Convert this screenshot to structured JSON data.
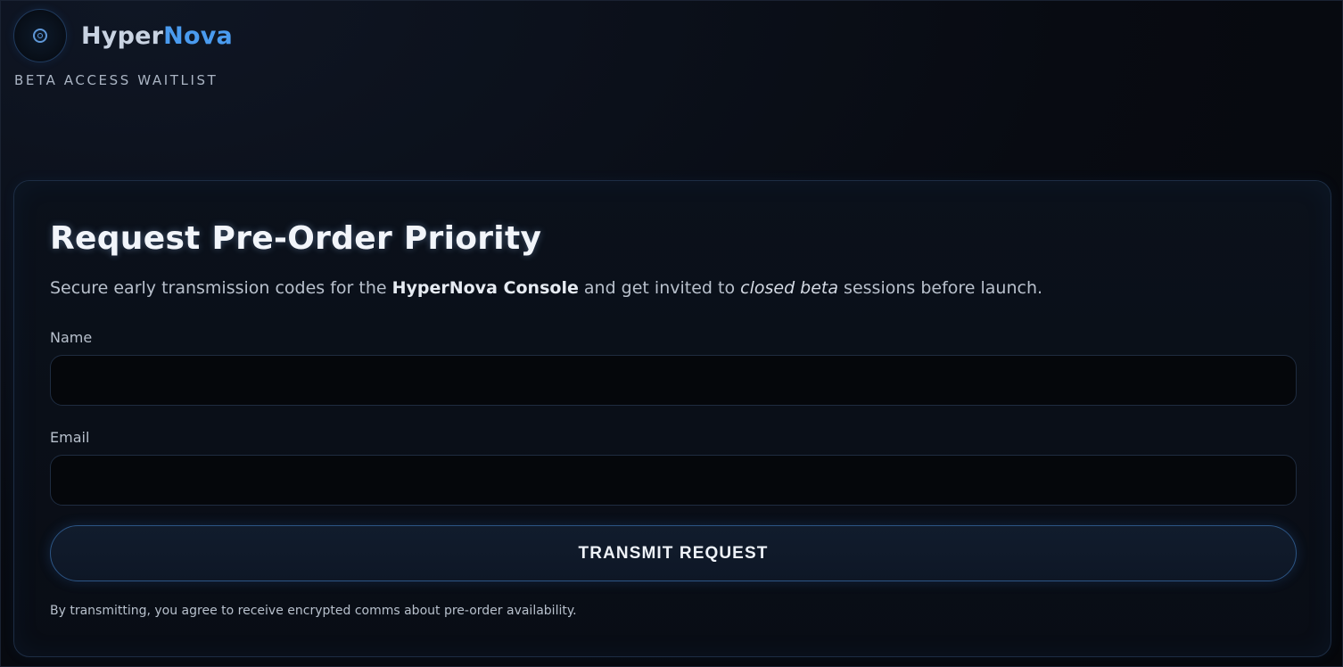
{
  "brand": {
    "name_primary": "Hyper",
    "name_accent": "Nova",
    "tagline": "BETA ACCESS WAITLIST",
    "logo_icon": "orbit-target-icon"
  },
  "card": {
    "title": "Request Pre-Order Priority",
    "description": {
      "part1": "Secure early transmission codes for the ",
      "bold": "HyperNova Console",
      "part2": " and get invited to ",
      "italic": "closed beta",
      "part3": " sessions before launch."
    },
    "fields": {
      "name_label": "Name",
      "name_value": "",
      "email_label": "Email",
      "email_value": ""
    },
    "submit_label": "TRANSMIT REQUEST",
    "footnote": "By transmitting, you agree to receive encrypted comms about pre-order availability."
  },
  "colors": {
    "accent": "#4a9bef",
    "background": "#080b12",
    "card_border": "#1d2d44",
    "button_border": "#2c5584"
  }
}
